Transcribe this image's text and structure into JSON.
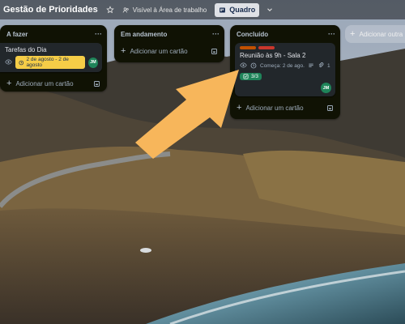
{
  "header": {
    "board_title": "Gestão de Prioridades",
    "visibility_label": "Visível à Área de trabalho",
    "view_label": "Quadro"
  },
  "lists": [
    {
      "title": "A fazer",
      "cards": [
        {
          "title": "Tarefas do Dia",
          "date": "2 de agosto - 2 de agosto",
          "member_initials": "JM"
        }
      ],
      "add_card_label": "Adicionar um cartão"
    },
    {
      "title": "Em andamento",
      "cards": [],
      "add_card_label": "Adicionar um cartão"
    },
    {
      "title": "Concluído",
      "cards": [
        {
          "title": "Reunião às 9h - Sala 2",
          "date": "Começa: 2 de ago.",
          "attachments": "1",
          "checklist": "3/3",
          "member_initials": "JM",
          "label_colors": [
            "#c25100",
            "#c9372c"
          ]
        }
      ],
      "add_card_label": "Adicionar um cartão"
    }
  ],
  "add_list_label": "Adicionar outra lista",
  "colors": {
    "list_bg": "#101204",
    "card_bg": "#22272b",
    "date_badge": "#f5cd47",
    "checklist_badge": "#1f845a",
    "avatar": "#1f845a",
    "arrow": "#f7b65b"
  }
}
